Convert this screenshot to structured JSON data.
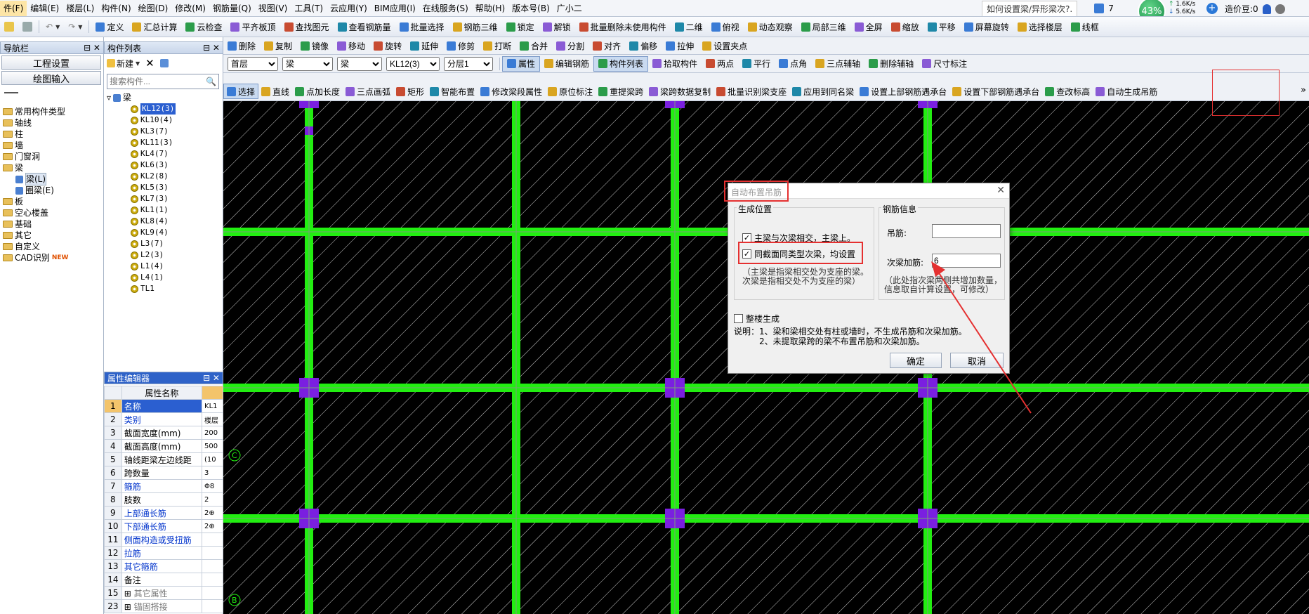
{
  "menu": [
    "件(F)",
    "编辑(E)",
    "楼层(L)",
    "构件(N)",
    "绘图(D)",
    "修改(M)",
    "钢筋量(Q)",
    "视图(V)",
    "工具(T)",
    "云应用(Y)",
    "BIM应用(I)",
    "在线服务(S)",
    "帮助(H)",
    "版本号(B)",
    "广小二"
  ],
  "top_right": {
    "question": "如何设置梁/异形梁次?.",
    "badge": "7",
    "percent": "43%",
    "up_speed": "1.6K/s",
    "down_speed": "5.6K/s",
    "price": "造价豆:0"
  },
  "toolbar1": [
    "定义",
    "汇总计算",
    "云检查",
    "平齐板顶",
    "查找图元",
    "查看钢筋量",
    "批量选择",
    "钢筋三维",
    "锁定",
    "解锁",
    "批量删除未使用构件",
    "二维",
    "俯视",
    "动态观察",
    "局部三维",
    "全屏",
    "缩放",
    "平移",
    "屏幕旋转",
    "选择楼层",
    "线框"
  ],
  "toolbar2": [
    "删除",
    "复制",
    "镜像",
    "移动",
    "旋转",
    "延伸",
    "修剪",
    "打断",
    "合并",
    "分割",
    "对齐",
    "偏移",
    "拉伸",
    "设置夹点"
  ],
  "toolbar3": {
    "floor": "首层",
    "type1": "梁",
    "type2": "梁",
    "comp": "KL12(3)",
    "layer": "分层1",
    "items": [
      "属性",
      "编辑钢筋",
      "构件列表",
      "拾取构件",
      "两点",
      "平行",
      "点角",
      "三点辅轴",
      "删除辅轴",
      "尺寸标注"
    ]
  },
  "toolbar4": [
    "选择",
    "直线",
    "点加长度",
    "三点画弧",
    "矩形",
    "智能布置",
    "修改梁段属性",
    "原位标注",
    "重提梁跨",
    "梁跨数据复制",
    "批量识别梁支座",
    "应用到同名梁",
    "设置上部钢筋遇承台",
    "设置下部钢筋遇承台",
    "查改标高",
    "自动生成吊筋"
  ],
  "nav": {
    "title": "导航栏",
    "btn1": "工程设置",
    "btn2": "绘图输入",
    "items": [
      "常用构件类型",
      "轴线",
      "柱",
      "墙",
      "门窗洞",
      "梁",
      "梁(L)",
      "圈梁(E)",
      "板",
      "空心楼盖",
      "基础",
      "其它",
      "自定义",
      "CAD识别"
    ],
    "new_tag": "NEW"
  },
  "complist": {
    "title": "构件列表",
    "new": "新建",
    "search_placeholder": "搜索构件...",
    "root": "梁",
    "items": [
      "KL12(3)",
      "KL10(4)",
      "KL3(7)",
      "KL11(3)",
      "KL4(7)",
      "KL6(3)",
      "KL2(8)",
      "KL5(3)",
      "KL7(3)",
      "KL1(1)",
      "KL8(4)",
      "KL9(4)",
      "L3(7)",
      "L2(3)",
      "L1(4)",
      "L4(1)",
      "TL1"
    ]
  },
  "props": {
    "title": "属性编辑器",
    "header": "属性名称",
    "rows": [
      {
        "n": "1",
        "k": "名称",
        "v": "KL1"
      },
      {
        "n": "2",
        "k": "类别",
        "v": "楼层"
      },
      {
        "n": "3",
        "k": "截面宽度(mm)",
        "v": "200"
      },
      {
        "n": "4",
        "k": "截面高度(mm)",
        "v": "500"
      },
      {
        "n": "5",
        "k": "轴线距梁左边线距",
        "v": "(10"
      },
      {
        "n": "6",
        "k": "跨数量",
        "v": "3"
      },
      {
        "n": "7",
        "k": "箍筋",
        "v": "Φ8"
      },
      {
        "n": "8",
        "k": "肢数",
        "v": "2"
      },
      {
        "n": "9",
        "k": "上部通长筋",
        "v": "2⊕"
      },
      {
        "n": "10",
        "k": "下部通长筋",
        "v": "2⊕"
      },
      {
        "n": "11",
        "k": "侧面构造或受扭筋",
        "v": ""
      },
      {
        "n": "12",
        "k": "拉筋",
        "v": ""
      },
      {
        "n": "13",
        "k": "其它箍筋",
        "v": ""
      },
      {
        "n": "14",
        "k": "备注",
        "v": ""
      },
      {
        "n": "15",
        "k": "其它属性",
        "v": ""
      },
      {
        "n": "23",
        "k": "锚固搭接",
        "v": ""
      }
    ]
  },
  "dialog": {
    "title": "自动布置吊筋",
    "gen_pos": "生成位置",
    "opt1": "主梁与次梁相交，主梁上。",
    "opt2": "同截面同类型次梁，均设置",
    "note1": "（主梁是指梁相交处为支座的梁。",
    "note2": "次梁是指相交处不为支座的梁）",
    "rebar_info": "钢筋信息",
    "hanger_label": "吊筋:",
    "hanger_value": "",
    "extra_label": "次梁加筋:",
    "extra_value": "6",
    "hint1": "（此处指次梁两侧共增加数量，",
    "hint2": "信息取自计算设置，可修改）",
    "overall": "整楼生成",
    "desc1": "说明：1、梁和梁相交处有柱或墙时，不生成吊筋和次梁加筋。",
    "desc2": "2、未提取梁跨的梁不布置吊筋和次梁加筋。",
    "ok": "确定",
    "cancel": "取消"
  },
  "axis": {
    "left1": "C",
    "left2": "B"
  },
  "colors": {
    "beam": "#22ee11",
    "column": "#7a1fe0",
    "canvas": "#000000",
    "hatch": "#d8d8d8",
    "highlight": "#e60000"
  }
}
